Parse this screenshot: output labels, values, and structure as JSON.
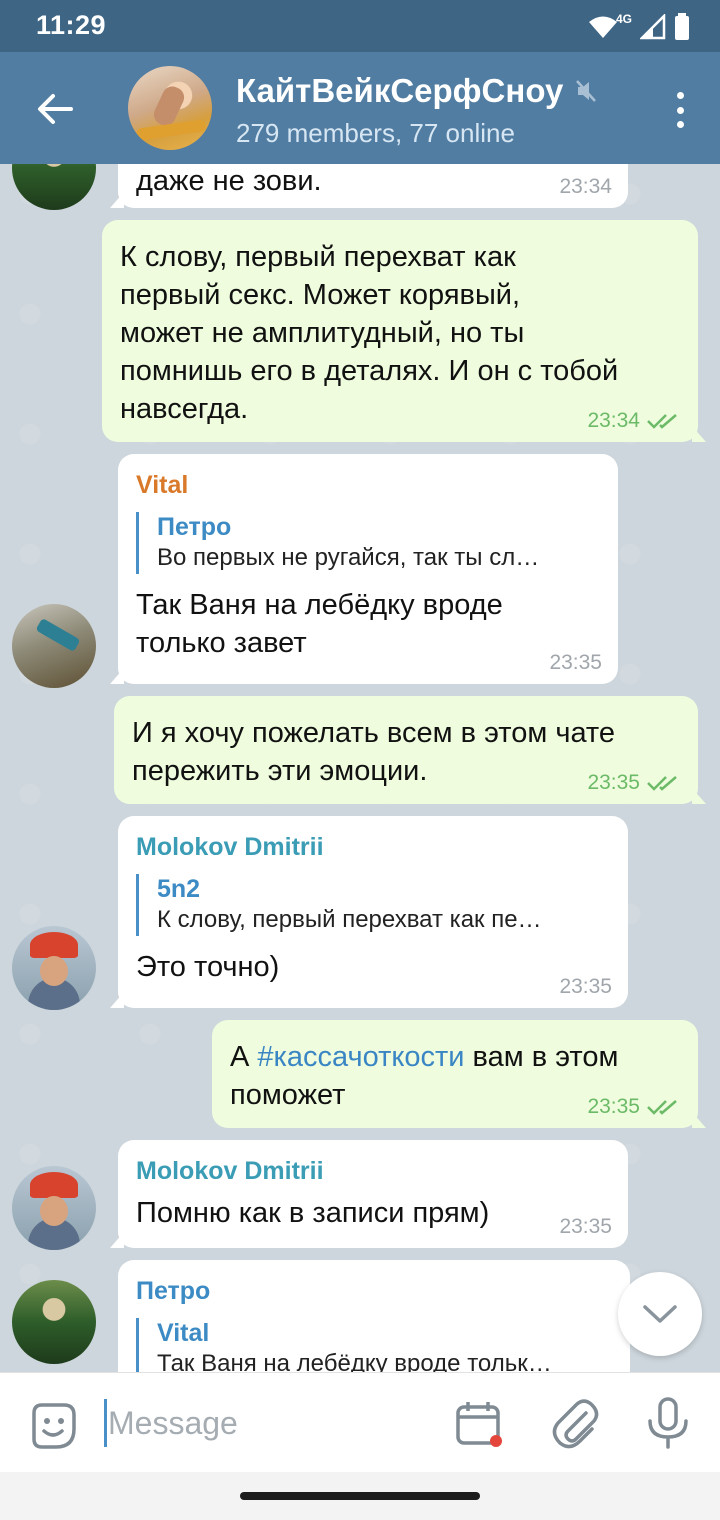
{
  "status_bar": {
    "time": "11:29",
    "network": "4G"
  },
  "header": {
    "title": "КайтВейкСерфСноу",
    "subtitle": "279 members, 77 online"
  },
  "messages": [
    {
      "id": "m0",
      "direction": "in",
      "text": "даже не зови.",
      "time": "23:34"
    },
    {
      "id": "m1",
      "direction": "out",
      "lines": [
        "К слову, первый перехват как",
        "первый секс. Может корявый,",
        "может не амплитудный, но ты",
        "помнишь его в деталях. И он с тобой",
        "навсегда."
      ],
      "time": "23:34"
    },
    {
      "id": "m2",
      "direction": "in",
      "sender": "Vital",
      "sender_color": "#d97a2b",
      "reply_name": "Петро",
      "reply_text": "Во первых не ругайся, так ты сл…",
      "lines": [
        "Так Ваня на лебёдку вроде",
        "только завет"
      ],
      "time": "23:35"
    },
    {
      "id": "m3",
      "direction": "out",
      "lines": [
        "И я хочу пожелать всем в этом чате",
        "пережить эти эмоции."
      ],
      "time": "23:35"
    },
    {
      "id": "m4",
      "direction": "in",
      "sender": "Molokov Dmitrii",
      "sender_color": "#3a9cb5",
      "reply_name": "5n2",
      "reply_text": "К слову, первый перехват как пе…",
      "text": "Это точно)",
      "time": "23:35"
    },
    {
      "id": "m5",
      "direction": "out",
      "prefix": "А ",
      "hashtag": "#кассачоткости",
      "suffix": " вам в этом",
      "line2": "поможет",
      "time": "23:35"
    },
    {
      "id": "m6",
      "direction": "in",
      "sender": "Molokov Dmitrii",
      "sender_color": "#3a9cb5",
      "text": "Помню как в записи прям)",
      "time": "23:35"
    },
    {
      "id": "m7",
      "direction": "in",
      "sender": "Петро",
      "sender_color": "#3d8bc4",
      "reply_name": "Vital",
      "reply_text": "Так Ваня на лебёдку вроде тольк…"
    }
  ],
  "input": {
    "placeholder": "Message"
  },
  "colors": {
    "header": "#517da2",
    "statusbar": "#3e6584",
    "outgoing_bubble": "#effdde",
    "read_check": "#6cba68"
  }
}
